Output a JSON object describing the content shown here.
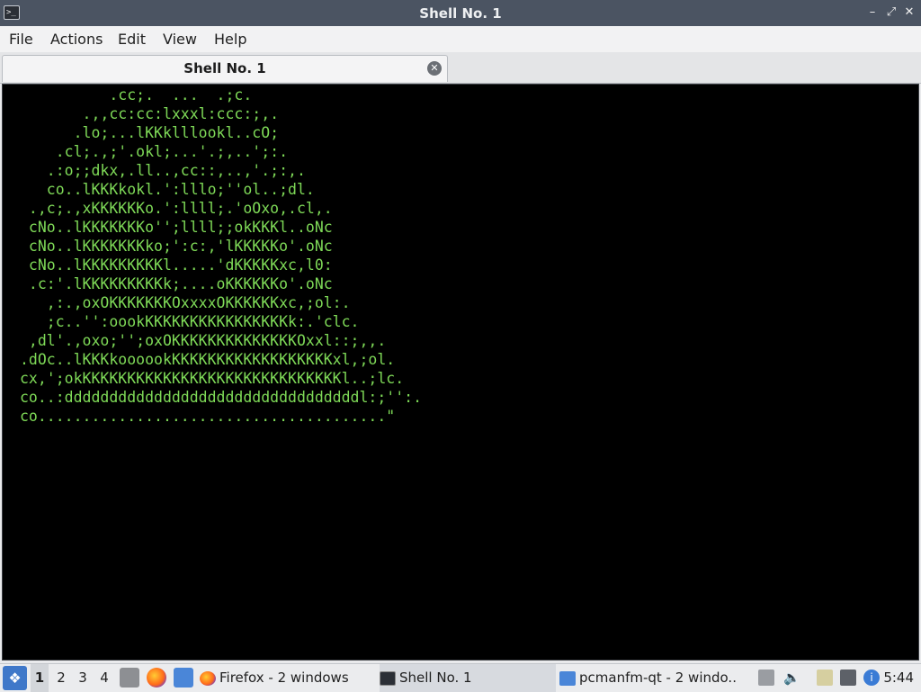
{
  "window": {
    "title": "Shell No. 1",
    "icon": "terminal-icon",
    "minimize_icon": "minimize-icon",
    "restore_icon": "restore-icon",
    "close_icon": "close-icon"
  },
  "menu": [
    "File",
    "Actions",
    "Edit",
    "View",
    "Help"
  ],
  "tab": {
    "label": "Shell No. 1",
    "close_icon": "tab-close-icon"
  },
  "terminal": {
    "text_color": "#7ed957",
    "lines": [
      "          .cc;.  ...  .;c.",
      "       .,,cc:cc:lxxxl:ccc:;,.",
      "      .lo;...lKKklllookl..cO;",
      "    .cl;.,;'.okl;...'.;,..';:.",
      "   .:o;;dkx,.ll..,cc::,..,'.;:,.",
      "   co..lKKKkokl.':lllo;''ol..;dl.",
      " .,c;.,xKKKKKKo.':llll;.'oOxo,.cl,.",
      " cNo..lKKKKKKKo'';llll;;okKKKl..oNc",
      " cNo..lKKKKKKKko;':c:,'lKKKKKo'.oNc",
      " cNo..lKKKKKKKKKl.....'dKKKKKxc,l0:",
      " .c:'.lKKKKKKKKKk;....oKKKKKKo'.oNc",
      "   ,:.,oxOKKKKKKKOxxxxOKKKKKKxc,;ol:.",
      "   ;c..'':oookKKKKKKKKKKKKKKKKk:.'clc.",
      " ,dl'.,oxo;'';oxOKKKKKKKKKKKKKKOxxl::;,,.",
      ".dOc..lKKKkoooookKKKKKKKKKKKKKKKKKKxl,;ol.",
      "cx,';okKKKKKKKKKKKKKKKKKKKKKKKKKKKKKl..;lc.",
      "co..:dddddddddddddddddddddddddddddddddl:;'':.",
      "co.......................................\""
    ]
  },
  "taskbar": {
    "start_icon": "lxqt-start-icon",
    "workspaces": [
      "1",
      "2",
      "3",
      "4"
    ],
    "active_workspace": "1",
    "quick_launch": [
      "file-manager-icon",
      "firefox-icon",
      "folder-icon"
    ],
    "tasks": [
      {
        "label": "Firefox - 2 windows",
        "icon": "firefox-icon"
      },
      {
        "label": "Shell No. 1",
        "icon": "terminal-icon"
      },
      {
        "label": "pcmanfm-qt - 2 windo...",
        "icon": "folder-icon"
      }
    ],
    "tray": [
      "eject-icon",
      "volume-icon",
      "clipboard-icon",
      "network-icon",
      "info-icon"
    ],
    "clock": "5:44"
  }
}
